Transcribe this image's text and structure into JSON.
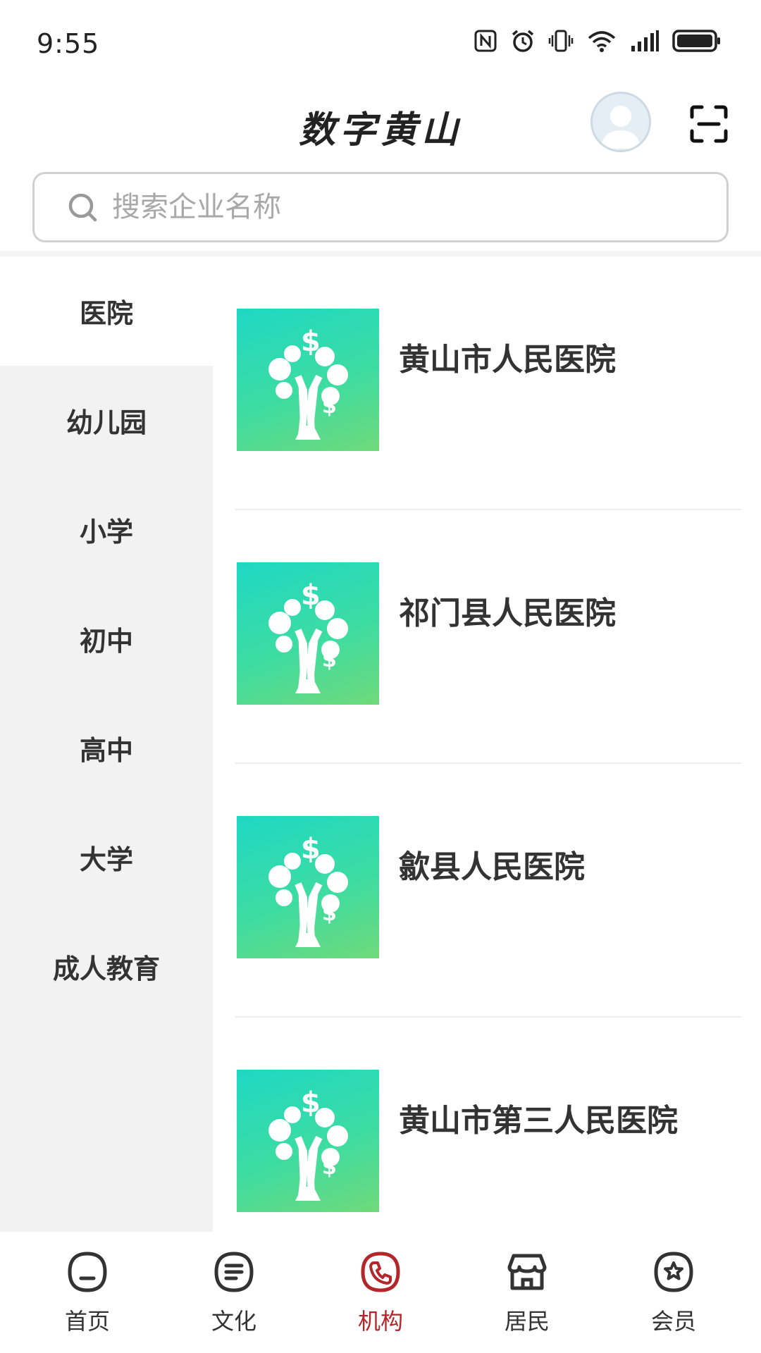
{
  "status_bar": {
    "time": "9:55",
    "icons": [
      "nfc-icon",
      "alarm-icon",
      "vibrate-icon",
      "wifi-icon",
      "signal-icon",
      "battery-icon"
    ]
  },
  "header": {
    "title": "数字黄山",
    "avatar_icon": "avatar-icon",
    "scan_icon": "scan-icon"
  },
  "search": {
    "placeholder": "搜索企业名称",
    "value": ""
  },
  "sidebar": {
    "items": [
      {
        "label": "医院",
        "active": true
      },
      {
        "label": "幼儿园",
        "active": false
      },
      {
        "label": "小学",
        "active": false
      },
      {
        "label": "初中",
        "active": false
      },
      {
        "label": "高中",
        "active": false
      },
      {
        "label": "大学",
        "active": false
      },
      {
        "label": "成人教育",
        "active": false
      }
    ]
  },
  "list": {
    "items": [
      {
        "name": "黄山市人民医院",
        "icon": "money-tree-logo"
      },
      {
        "name": "祁门县人民医院",
        "icon": "money-tree-logo"
      },
      {
        "name": "歙县人民医院",
        "icon": "money-tree-logo"
      },
      {
        "name": "黄山市第三人民医院",
        "icon": "money-tree-logo"
      }
    ]
  },
  "tabbar": {
    "active_color": "#b3262a",
    "tabs": [
      {
        "label": "首页",
        "icon": "home-icon"
      },
      {
        "label": "文化",
        "icon": "document-icon"
      },
      {
        "label": "机构",
        "icon": "phone-icon",
        "active": true
      },
      {
        "label": "居民",
        "icon": "shop-icon"
      },
      {
        "label": "会员",
        "icon": "star-badge-icon"
      }
    ]
  }
}
